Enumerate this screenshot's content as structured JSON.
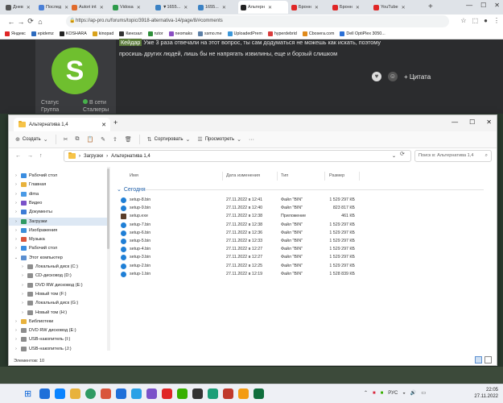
{
  "browser": {
    "tabs": [
      {
        "label": "Днев",
        "icon_color": "#555555"
      },
      {
        "label": "Послед",
        "icon_color": "#4a7fd6"
      },
      {
        "label": "Autori int",
        "icon_color": "#e06a2b"
      },
      {
        "label": "Vidosa",
        "icon_color": "#2e9b4b"
      },
      {
        "label": "▼1655...",
        "icon_color": "#3b82c4"
      },
      {
        "label": "1655...",
        "icon_color": "#3b82c4"
      },
      {
        "label": "Альтерн",
        "icon_color": "#222222",
        "active": true
      },
      {
        "label": "Бронн",
        "icon_color": "#e02626"
      },
      {
        "label": "Бронн",
        "icon_color": "#e02626"
      },
      {
        "label": "YouTube",
        "icon_color": "#e02626"
      }
    ],
    "url": "https://ap-pro.ru/forums/topic/3918-alternativa-14/page/8/#comments",
    "bookmarks": [
      {
        "label": "Яндекс",
        "color": "#e02626"
      },
      {
        "label": "epidemz",
        "color": "#2d6bbf"
      },
      {
        "label": "KOSHARA",
        "color": "#222222"
      },
      {
        "label": "kinopad",
        "color": "#d9a21b"
      },
      {
        "label": "Кинозал",
        "color": "#333333"
      },
      {
        "label": "rutor",
        "color": "#2f8f3a"
      },
      {
        "label": "neomaks",
        "color": "#8a4fc2"
      },
      {
        "label": "ssmo.me",
        "color": "#5c7fa6"
      },
      {
        "label": "UploadedPrem",
        "color": "#3c97d9"
      },
      {
        "label": "hyperdebrid",
        "color": "#d93c3c"
      },
      {
        "label": "Cbosera.com",
        "color": "#e08a1b"
      },
      {
        "label": "Dell OptiPlex 3050...",
        "color": "#2a6fd6"
      }
    ]
  },
  "forum": {
    "avatar_letter": "S",
    "status_label": "Статус",
    "group_label": "Группа",
    "online_label": "В сети",
    "group_value": "Сталкеры",
    "post_nick": "Кейдар",
    "post_line1": " Уже 3 раза отвечали на этот вопрос, ты сам додуматься не можешь как искать, поэтому",
    "post_line2": "просишь других людей, лишь бы не напрягать извилины, еще и борзый слишком",
    "quote_label": "Цитата"
  },
  "explorer": {
    "tab_title": "Альтернатива 1,4",
    "toolbar": {
      "create": "Создать",
      "sort": "Сортировать",
      "view": "Просмотреть"
    },
    "path": [
      "Загрузки",
      "Альтернатива 1,4"
    ],
    "search_placeholder": "Поиск в: Альтернатива 1,4",
    "nav": [
      {
        "label": "Рабочий стол",
        "color": "#3a8de0",
        "level": 0,
        "selected": false
      },
      {
        "label": "Главная",
        "color": "#e8b23c",
        "level": 0,
        "selected": false
      },
      {
        "label": "dima",
        "color": "#4a9ae6",
        "level": 0,
        "selected": false
      },
      {
        "label": "Видео",
        "color": "#7a52c9",
        "level": 0,
        "selected": false
      },
      {
        "label": "Документы",
        "color": "#3c7bd6",
        "level": 0,
        "selected": false
      },
      {
        "label": "Загрузки",
        "color": "#2f9a63",
        "level": 0,
        "selected": true
      },
      {
        "label": "Изображения",
        "color": "#3b8fd9",
        "level": 0,
        "selected": false
      },
      {
        "label": "Музыка",
        "color": "#d9563c",
        "level": 0,
        "selected": false
      },
      {
        "label": "Рабочий стол",
        "color": "#3a8de0",
        "level": 0,
        "selected": false
      },
      {
        "label": "Этот компьютер",
        "color": "#5b8fd0",
        "level": 0,
        "selected": false
      },
      {
        "label": "Локальный диск (C:)",
        "color": "#8d8d8d",
        "level": 1,
        "selected": false
      },
      {
        "label": "CD-дисковод (D:)",
        "color": "#8d8d8d",
        "level": 1,
        "selected": false
      },
      {
        "label": "DVD RW дисковод (E:)",
        "color": "#8d8d8d",
        "level": 1,
        "selected": false
      },
      {
        "label": "Новый том (F:)",
        "color": "#8d8d8d",
        "level": 1,
        "selected": false
      },
      {
        "label": "Локальный диск (G:)",
        "color": "#8d8d8d",
        "level": 1,
        "selected": false
      },
      {
        "label": "Новый том (H:)",
        "color": "#8d8d8d",
        "level": 1,
        "selected": false
      },
      {
        "label": "Библиотеки",
        "color": "#e8b23c",
        "level": 0,
        "selected": false
      },
      {
        "label": "DVD RW дисковод (E:)",
        "color": "#8d8d8d",
        "level": 0,
        "selected": false
      },
      {
        "label": "USB-накопитель (I:)",
        "color": "#8d8d8d",
        "level": 0,
        "selected": false
      },
      {
        "label": "USB-накопитель (J:)",
        "color": "#8d8d8d",
        "level": 0,
        "selected": false
      }
    ],
    "columns": [
      "Имя",
      "Дата изменения",
      "Тип",
      "Размер"
    ],
    "group_label": "Сегодня",
    "files": [
      {
        "name": "setup-8.bin",
        "date": "27.11.2022 в 12:41",
        "type": "Файл \"BIN\"",
        "size": "1 529 297 КБ",
        "kind": "bin"
      },
      {
        "name": "setup-9.bin",
        "date": "27.11.2022 в 12:40",
        "type": "Файл \"BIN\"",
        "size": "823 817 КБ",
        "kind": "bin"
      },
      {
        "name": "setup.exe",
        "date": "27.11.2022 в 12:38",
        "type": "Приложение",
        "size": "461 КБ",
        "kind": "exe"
      },
      {
        "name": "setup-7.bin",
        "date": "27.11.2022 в 12:38",
        "type": "Файл \"BIN\"",
        "size": "1 529 297 КБ",
        "kind": "bin"
      },
      {
        "name": "setup-6.bin",
        "date": "27.11.2022 в 12:36",
        "type": "Файл \"BIN\"",
        "size": "1 529 297 КБ",
        "kind": "bin"
      },
      {
        "name": "setup-5.bin",
        "date": "27.11.2022 в 12:33",
        "type": "Файл \"BIN\"",
        "size": "1 529 297 КБ",
        "kind": "bin"
      },
      {
        "name": "setup-4.bin",
        "date": "27.11.2022 в 12:27",
        "type": "Файл \"BIN\"",
        "size": "1 529 297 КБ",
        "kind": "bin"
      },
      {
        "name": "setup-3.bin",
        "date": "27.11.2022 в 12:27",
        "type": "Файл \"BIN\"",
        "size": "1 529 297 КБ",
        "kind": "bin"
      },
      {
        "name": "setup-2.bin",
        "date": "27.11.2022 в 12:25",
        "type": "Файл \"BIN\"",
        "size": "1 529 297 КБ",
        "kind": "bin"
      },
      {
        "name": "setup-1.bin",
        "date": "27.11.2022 в 12:19",
        "type": "Файл \"BIN\"",
        "size": "1 528 839 КБ",
        "kind": "bin"
      }
    ],
    "status": "Элементов: 10"
  },
  "taskbar": {
    "icon_colors": [
      "#1e6fd9",
      "#0a84ff",
      "#e8b23c",
      "#2f9a63",
      "#d9563c",
      "#1e6fd9",
      "#2aa1e6",
      "#7a52c9",
      "#e02626",
      "#38b000",
      "#333333",
      "#1b9e77",
      "#c0392b",
      "#f39c12",
      "#0f6e3c"
    ],
    "tray_lang": "РУС",
    "time": "22:05",
    "date": "27.11.2022"
  }
}
